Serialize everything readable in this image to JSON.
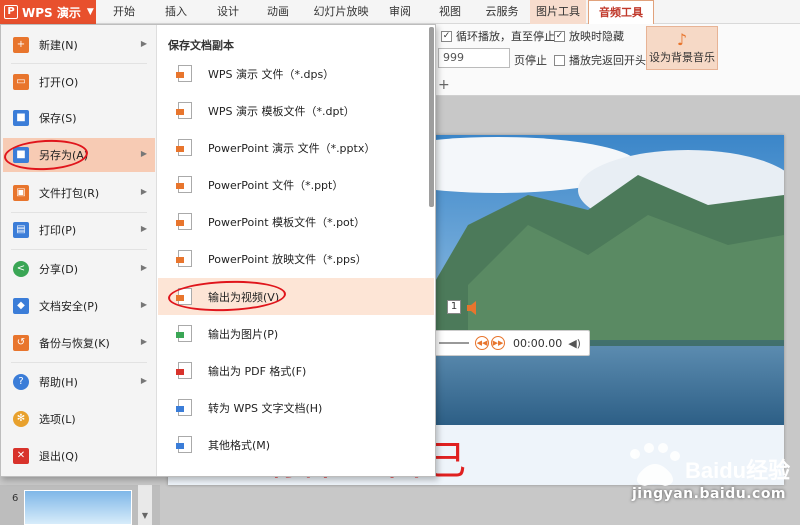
{
  "app": {
    "menu_button": "WPS 演示",
    "logo_glyph": "P"
  },
  "tabs": [
    {
      "label": "开始"
    },
    {
      "label": "插入"
    },
    {
      "label": "设计"
    },
    {
      "label": "动画"
    },
    {
      "label": "幻灯片放映"
    },
    {
      "label": "审阅"
    },
    {
      "label": "视图"
    },
    {
      "label": "云服务"
    },
    {
      "label": "图片工具"
    },
    {
      "label": "音频工具"
    }
  ],
  "ribbon": {
    "loop_label": "循环播放，直至停止",
    "loop_checked": true,
    "hide_label": "放映时隐藏",
    "hide_checked": true,
    "rewind_label": "播放完返回开头",
    "rewind_checked": false,
    "page_value": "999",
    "page_stop_label": "页停止",
    "bgm_label": "设为背景音乐",
    "plus_glyph": "+"
  },
  "file_menu": {
    "left_items": [
      {
        "label": "新建(N)",
        "icon": "new-file-icon",
        "has_sub": true
      },
      {
        "label": "打开(O)",
        "icon": "folder-icon",
        "has_sub": false
      },
      {
        "label": "保存(S)",
        "icon": "save-icon",
        "has_sub": false
      },
      {
        "label": "另存为(A)",
        "icon": "save-as-icon",
        "has_sub": true,
        "selected": true
      },
      {
        "label": "文件打包(R)",
        "icon": "package-icon",
        "has_sub": true
      },
      {
        "label": "打印(P)",
        "icon": "print-icon",
        "has_sub": true
      },
      {
        "label": "分享(D)",
        "icon": "share-icon",
        "has_sub": true
      },
      {
        "label": "文档安全(P)",
        "icon": "security-icon",
        "has_sub": true
      },
      {
        "label": "备份与恢复(K)",
        "icon": "backup-icon",
        "has_sub": true
      },
      {
        "label": "帮助(H)",
        "icon": "help-icon",
        "has_sub": true
      },
      {
        "label": "选项(L)",
        "icon": "gear-icon",
        "has_sub": false
      },
      {
        "label": "退出(Q)",
        "icon": "exit-icon",
        "has_sub": false
      }
    ],
    "submenu_title": "保存文档副本",
    "right_items": [
      {
        "label": "WPS 演示 文件（*.dps）",
        "icon": "dps-file-icon"
      },
      {
        "label": "WPS 演示 模板文件（*.dpt）",
        "icon": "dpt-file-icon"
      },
      {
        "label": "PowerPoint 演示 文件（*.pptx）",
        "icon": "pptx-file-icon"
      },
      {
        "label": "PowerPoint 文件（*.ppt）",
        "icon": "ppt-file-icon"
      },
      {
        "label": "PowerPoint 模板文件（*.pot）",
        "icon": "pot-file-icon"
      },
      {
        "label": "PowerPoint 放映文件（*.pps）",
        "icon": "pps-file-icon"
      },
      {
        "label": "输出为视频(V)",
        "icon": "video-file-icon",
        "selected": true
      },
      {
        "label": "输出为图片(P)",
        "icon": "image-file-icon"
      },
      {
        "label": "输出为 PDF 格式(F)",
        "icon": "pdf-file-icon"
      },
      {
        "label": "转为 WPS 文字文档(H)",
        "icon": "wps-doc-icon"
      },
      {
        "label": "其他格式(M)",
        "icon": "other-format-icon"
      }
    ]
  },
  "slide": {
    "caption": "请保重自己",
    "audio_number": "1",
    "audio_time": "00:00.00",
    "thumbnail_number": "6"
  },
  "watermark": {
    "logo": "Baidu经验",
    "url": "jingyan.baidu.com"
  },
  "colors": {
    "accent": "#e8502d",
    "selection": "#f7cbb4",
    "annotation": "#e0151c"
  }
}
